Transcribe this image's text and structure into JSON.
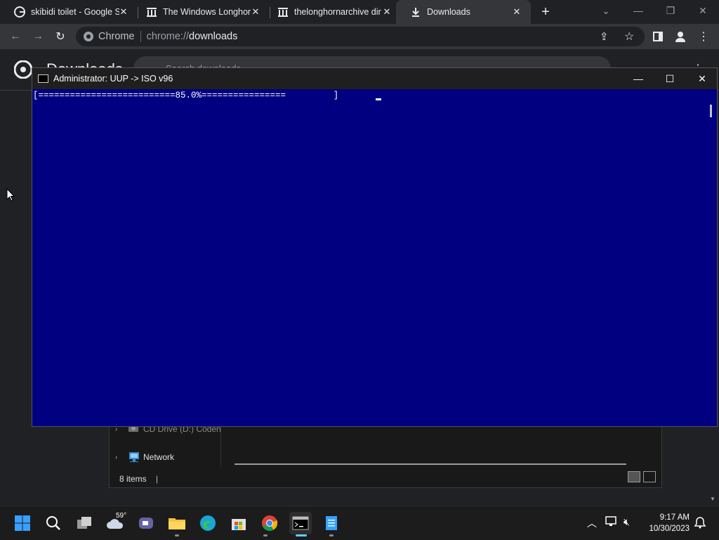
{
  "browser": {
    "tabs": [
      {
        "title": "skibidi toilet - Google S",
        "favicon": "google-g-icon",
        "active": false
      },
      {
        "title": "The Windows Longhorn",
        "favicon": "archive-icon",
        "active": false
      },
      {
        "title": "thelonghornarchive dir",
        "favicon": "archive-icon",
        "active": false
      },
      {
        "title": "Downloads",
        "favicon": "download-icon",
        "active": true
      }
    ],
    "new_tab": "+",
    "omnibox": {
      "site": "Chrome",
      "scheme": "chrome://",
      "path": "downloads"
    }
  },
  "downloads_page": {
    "title": "Downloads",
    "search_placeholder": "Search downloads"
  },
  "explorer": {
    "nav_items": [
      {
        "label": "CD Drive (D:) Coden",
        "icon": "cd-drive-icon"
      },
      {
        "label": "Network",
        "icon": "network-icon"
      }
    ],
    "status": "8 items"
  },
  "console": {
    "title": "Administrator:  UUP -> ISO v96",
    "progress_line": "[==========================85.0%================         ]",
    "progress_fraction": 0.85
  },
  "taskbar": {
    "weather_temp": "59°",
    "clock_time": "9:17 AM",
    "clock_date": "10/30/2023"
  },
  "colors": {
    "console_bg": "#000080",
    "chrome_dark": "#202124",
    "toolbar": "#35363a",
    "windows_blue": "#0078d4"
  }
}
